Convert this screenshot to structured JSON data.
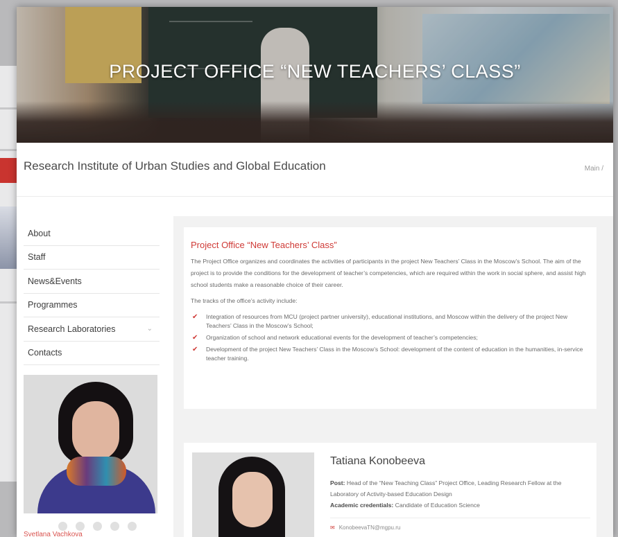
{
  "hero": {
    "title": "PROJECT OFFICE “NEW TEACHERS’ CLASS”"
  },
  "header": {
    "institute": "Research Institute of Urban Studies and Global Education",
    "breadcrumb": "Main /"
  },
  "sidebar": {
    "items": [
      {
        "label": "About",
        "has_submenu": false
      },
      {
        "label": "Staff",
        "has_submenu": false
      },
      {
        "label": "News&Events",
        "has_submenu": false
      },
      {
        "label": "Programmes",
        "has_submenu": false
      },
      {
        "label": "Research Laboratories",
        "has_submenu": true
      },
      {
        "label": "Contacts",
        "has_submenu": false
      }
    ],
    "featured_name": "Svetlana Vachkova"
  },
  "office": {
    "heading": "Project Office “New Teachers’ Class”",
    "intro": "The Project Office organizes and coordinates the activities of participants in the project New Teachers’ Class in the Moscow’s School. The aim of the project is to provide the conditions for the development of teacher’s competencies, which are required within the work in social sphere, and assist high school students make a reasonable choice of their career.",
    "tracks_intro": "The tracks of the office’s activity include:",
    "tracks": [
      "Integration of resources from MCU (project partner university), educational institutions, and Moscow within the delivery of the project New Teachers’ Class in the Moscow’s School;",
      "Organization of school and network educational events for the development of teacher’s competencies;",
      "Development of the project New Teachers’ Class in the Moscow’s School: development of the content of education in the humanities, in-service teacher training."
    ]
  },
  "person": {
    "name": "Tatiana Konobeeva",
    "post_label": "Post:",
    "post": "Head of the “New Teaching Class” Project Office, Leading Research Fellow at the Laboratory of Activity-based Education Design",
    "credentials_label": "Academic credentials:",
    "credentials": "Candidate of Education Science",
    "email": "KonobeevaTN@mgpu.ru"
  },
  "colors": {
    "accent": "#cf3a36",
    "panel": "#f2f2f2"
  }
}
